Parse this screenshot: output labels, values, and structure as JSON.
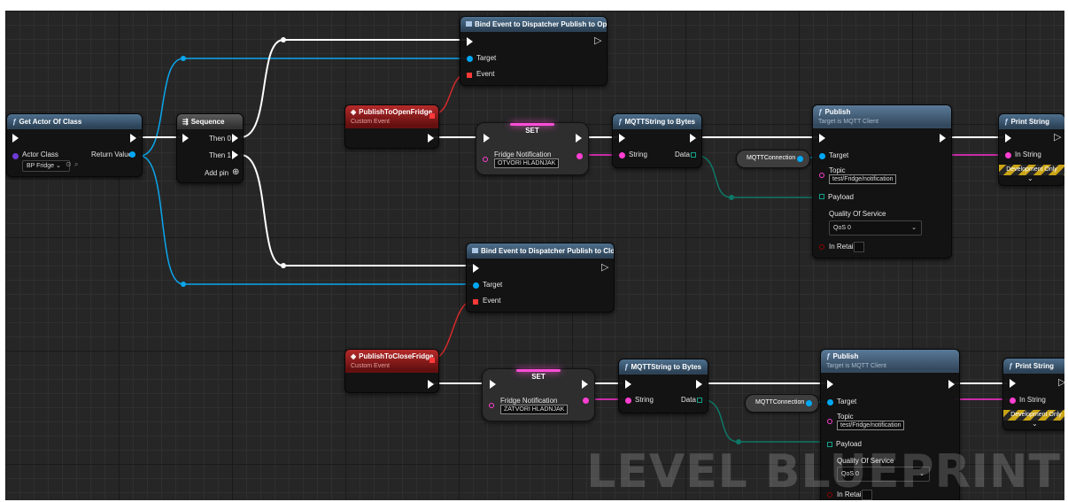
{
  "colors": {
    "exec": "#ffffff",
    "object_pin": "#00a8f4",
    "string_pin": "#ff3fd2",
    "byte_pin": "#0e6e5f",
    "delegate_pin": "#ff3838",
    "accent": "#ff4fd7"
  },
  "icons": {
    "function": "function-icon",
    "sequence": "sequence-icon",
    "event": "custom-event-icon",
    "delegate": "delegate-icon",
    "add": "plus-circle-icon"
  },
  "get_actor": {
    "title": "Get Actor Of Class",
    "actor_class": "Actor Class",
    "return_value": "Return Value",
    "class_value": "BP Fridge"
  },
  "sequence": {
    "title": "Sequence",
    "then0": "Then 0",
    "then1": "Then 1",
    "add_pin": "Add pin"
  },
  "bind_open": {
    "title": "Bind Event to Dispatcher Publish to Open",
    "target": "Target",
    "event": "Event"
  },
  "bind_close": {
    "title": "Bind Event to Dispatcher Publish to Close",
    "target": "Target",
    "event": "Event"
  },
  "open_event": {
    "title": "PublishToOpenFridge",
    "subtitle": "Custom Event"
  },
  "close_event": {
    "title": "PublishToCloseFridge",
    "subtitle": "Custom Event"
  },
  "set_open": {
    "title": "SET",
    "var_label": "Fridge Notification",
    "value": "OTVORI HLADNJAK"
  },
  "set_close": {
    "title": "SET",
    "var_label": "Fridge Notification",
    "value": "ZATVORI HLADNJAK"
  },
  "mqtt_open": {
    "title": "MQTTString to Bytes",
    "string": "String",
    "data": "Data"
  },
  "mqtt_close": {
    "title": "MQTTString to Bytes",
    "string": "String",
    "data": "Data"
  },
  "conn_open": {
    "label": "MQTTConnection"
  },
  "conn_close": {
    "label": "MQTTConnection"
  },
  "publish_open": {
    "title": "Publish",
    "subtitle": "Target is MQTT Client",
    "target": "Target",
    "topic": "Topic",
    "topic_value": "test/Fridge/notification",
    "payload": "Payload",
    "qos": "Quality Of Service",
    "qos_value": "QoS 0",
    "retain": "In Retain"
  },
  "publish_close": {
    "title": "Publish",
    "subtitle": "Target is MQTT Client",
    "target": "Target",
    "topic": "Topic",
    "topic_value": "test/Fridge/notification",
    "payload": "Payload",
    "qos": "Quality Of Service",
    "qos_value": "QoS 0",
    "retain": "In Retain"
  },
  "print_open": {
    "title": "Print String",
    "in_string": "In String",
    "dev_only": "Development Only"
  },
  "print_close": {
    "title": "Print String",
    "in_string": "In String",
    "dev_only": "Development Only"
  },
  "watermark": "LEVEL BLUEPRINT"
}
